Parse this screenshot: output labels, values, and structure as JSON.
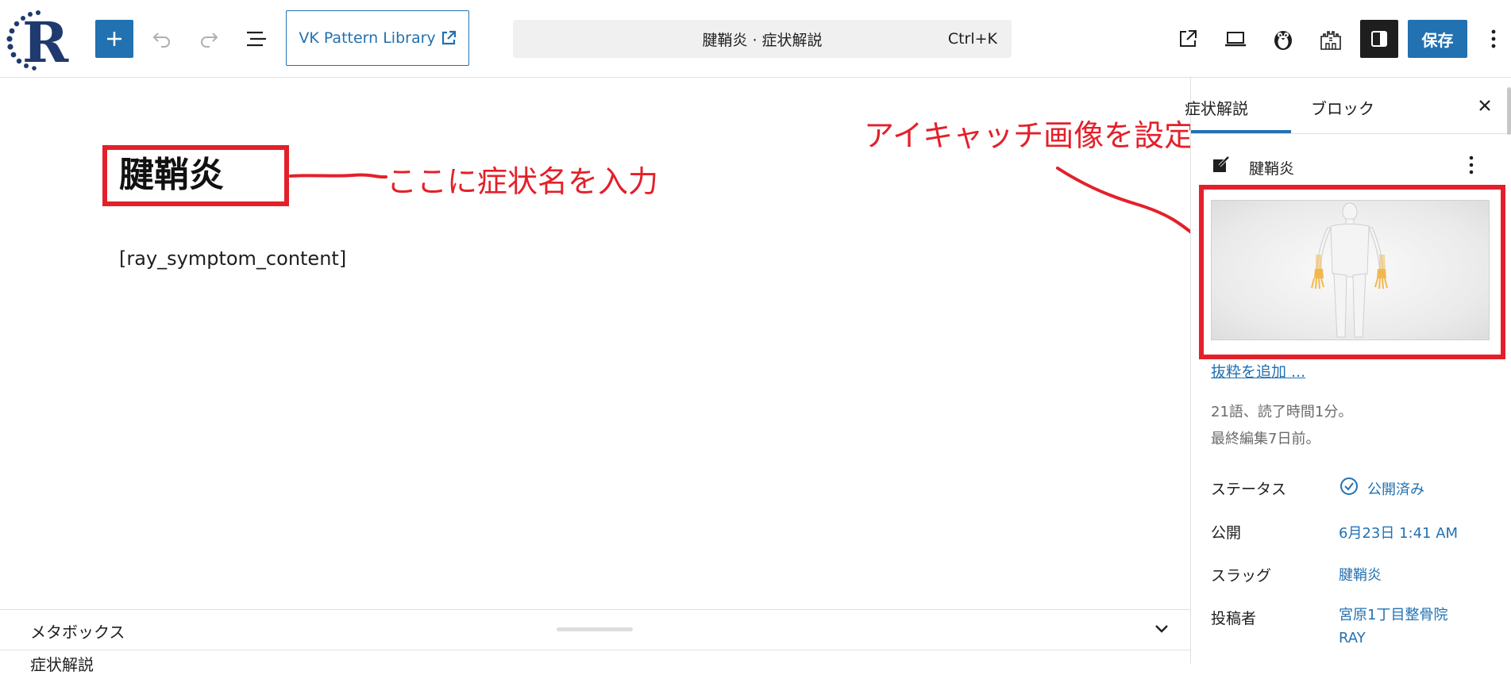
{
  "toolbar": {
    "vk_label": "VK Pattern Library",
    "command_title": "腱鞘炎 · 症状解説",
    "command_shortcut": "Ctrl+K",
    "save_label": "保存"
  },
  "editor": {
    "post_title": "腱鞘炎",
    "title_annotation": "ここに症状名を入力",
    "shortcode": "[ray_symptom_content]",
    "thumbnail_annotation": "アイキャッチ画像を設定"
  },
  "metabox": {
    "label": "メタボックス",
    "sub_label": "症状解説"
  },
  "sidebar": {
    "tabs": [
      "症状解説",
      "ブロック"
    ],
    "doc_title": "腱鞘炎",
    "excerpt_link": "抜粋を追加 ...",
    "word_count": "21語、読了時間1分。",
    "last_edited": "最終編集7日前。",
    "rows": {
      "status": {
        "label": "ステータス",
        "value": "公開済み"
      },
      "publish": {
        "label": "公開",
        "value": "6月23日 1:41 AM"
      },
      "slug": {
        "label": "スラッグ",
        "value": "腱鞘炎"
      },
      "author": {
        "label": "投稿者",
        "value": "宮原1丁目整骨院 RAY"
      }
    }
  },
  "colors": {
    "accent": "#2271b1",
    "annotation": "#e3202a",
    "dark": "#1e1e1e"
  }
}
